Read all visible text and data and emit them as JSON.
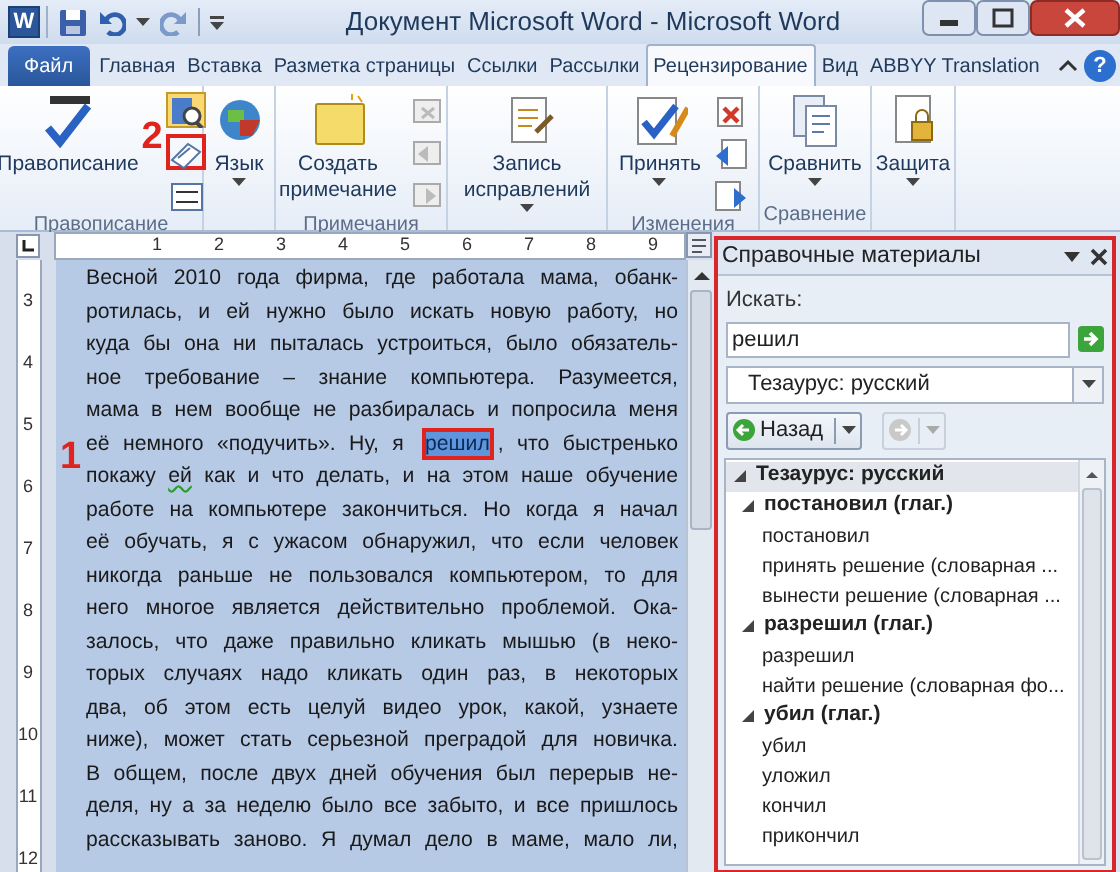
{
  "window": {
    "app_logo": "W",
    "title": "Документ Microsoft Word - Microsoft Word"
  },
  "tabs": [
    {
      "label": "Файл",
      "kind": "file",
      "selected": false
    },
    {
      "label": "Главная",
      "kind": "tab",
      "selected": false
    },
    {
      "label": "Вставка",
      "kind": "tab",
      "selected": false
    },
    {
      "label": "Разметка страницы",
      "kind": "tab",
      "selected": false
    },
    {
      "label": "Ссылки",
      "kind": "tab",
      "selected": false
    },
    {
      "label": "Рассылки",
      "kind": "tab",
      "selected": false
    },
    {
      "label": "Рецензирование",
      "kind": "tab",
      "selected": true
    },
    {
      "label": "Вид",
      "kind": "tab",
      "selected": false
    },
    {
      "label": "ABBYY Translation",
      "kind": "tab",
      "selected": false
    }
  ],
  "help_button": {
    "label": "?"
  },
  "ribbon_groups": [
    {
      "caption": "Правописание",
      "buttons": [
        {
          "kind": "large",
          "label": "Правописание",
          "has_menu": false
        },
        {
          "kind": "small",
          "pressed": true
        },
        {
          "kind": "small",
          "pressed": false,
          "callout": "2"
        },
        {
          "kind": "small",
          "pressed": false
        }
      ]
    },
    {
      "buttons": [
        {
          "kind": "large",
          "label": "Язык",
          "has_menu": true
        }
      ]
    },
    {
      "caption": "Примечания",
      "buttons": [
        {
          "kind": "large",
          "label": "Создать примечание",
          "has_menu": false
        },
        {
          "kind": "small",
          "pressed": false
        },
        {
          "kind": "small",
          "pressed": false
        },
        {
          "kind": "small",
          "pressed": false
        }
      ]
    },
    {
      "buttons": [
        {
          "kind": "large",
          "label": "Запись исправлений",
          "has_menu": true
        }
      ]
    },
    {
      "caption": "Изменения",
      "buttons": [
        {
          "kind": "large",
          "label": "Принять",
          "has_menu": true
        },
        {
          "kind": "small",
          "pressed": false
        },
        {
          "kind": "small",
          "pressed": false
        },
        {
          "kind": "small",
          "pressed": false
        }
      ]
    },
    {
      "caption": "Сравнение",
      "buttons": [
        {
          "kind": "large",
          "label": "Сравнить",
          "has_menu": true
        }
      ]
    },
    {
      "buttons": [
        {
          "kind": "large",
          "label": "Защита",
          "has_menu": true
        }
      ]
    }
  ],
  "ruler": {
    "horizontal": [
      "1",
      "2",
      "3",
      "4",
      "5",
      "6",
      "7",
      "8",
      "9"
    ],
    "vertical": [
      "3",
      "4",
      "5",
      "6",
      "7",
      "8",
      "9",
      "10",
      "11",
      "12"
    ]
  },
  "document": {
    "lines": [
      {
        "spans": [
          {
            "text": "Весной 2010 года фирма, где работала мама, обанк-"
          }
        ]
      },
      {
        "spans": [
          {
            "text": "ротилась, и ей нужно было искать новую работу, но"
          }
        ]
      },
      {
        "spans": [
          {
            "text": "куда бы она ни пыталась устроиться, было обязатель-"
          }
        ]
      },
      {
        "spans": [
          {
            "text": "ное требование – знание компьютера. Разумеется,"
          }
        ]
      },
      {
        "spans": [
          {
            "text": "мама в нем вообще не разбиралась и попросила меня"
          }
        ]
      },
      {
        "spans": [
          {
            "text": "её немного «подучить». Ну, я "
          },
          {
            "text": "решил",
            "selected": true,
            "callout": "1"
          },
          {
            "text": ", что быстренько"
          }
        ]
      },
      {
        "spans": [
          {
            "text": "покажу "
          },
          {
            "text": "ей",
            "grammar_error": true
          },
          {
            "text": " как и что делать, и на этом наше обучение"
          }
        ]
      },
      {
        "spans": [
          {
            "text": "работе на компьютере закончиться. Но когда я начал"
          }
        ]
      },
      {
        "spans": [
          {
            "text": "её обучать, я с ужасом обнаружил, что если человек"
          }
        ]
      },
      {
        "spans": [
          {
            "text": "никогда раньше не пользовался компьютером, то для"
          }
        ]
      },
      {
        "spans": [
          {
            "text": "него многое является действительно проблемой. Ока-"
          }
        ]
      },
      {
        "spans": [
          {
            "text": "залось, что даже правильно кликать мышью (в неко-"
          }
        ]
      },
      {
        "spans": [
          {
            "text": "торых случаях надо кликать один раз, в некоторых"
          }
        ]
      },
      {
        "spans": [
          {
            "text": "два, об этом есть целуй видео урок, какой, узнаете"
          }
        ]
      },
      {
        "spans": [
          {
            "text": "ниже), может стать серьезной преградой для новичка."
          }
        ]
      },
      {
        "spans": [
          {
            "text": "В общем, после двух дней обучения был перерыв не-"
          }
        ]
      },
      {
        "spans": [
          {
            "text": "деля, ну а за неделю было все забыто, и все пришлось"
          }
        ]
      },
      {
        "spans": [
          {
            "text": "рассказывать заново. Я думал дело в маме, мало ли,"
          }
        ]
      }
    ]
  },
  "reference_pane": {
    "title": "Справочные материалы",
    "search_label": "Искать:",
    "search_value": "решил",
    "source": "Тезаурус: русский",
    "back_button": {
      "label": "Назад",
      "disabled": false
    },
    "forward_button": {
      "disabled": true
    },
    "tree": [
      {
        "label": "Тезаурус: русский",
        "kind": "root",
        "expanded": true,
        "children": [
          {
            "label": "постановил (глаг.)",
            "kind": "group",
            "expanded": true,
            "children": [
              {
                "label": "постановил",
                "kind": "leaf"
              },
              {
                "label": "принять решение (словарная ...",
                "kind": "leaf"
              },
              {
                "label": "вынести решение (словарная ...",
                "kind": "leaf"
              }
            ]
          },
          {
            "label": "разрешил (глаг.)",
            "kind": "group",
            "expanded": true,
            "children": [
              {
                "label": "разрешил",
                "kind": "leaf"
              },
              {
                "label": "найти решение (словарная фо...",
                "kind": "leaf"
              }
            ]
          },
          {
            "label": "убил (глаг.)",
            "kind": "group",
            "expanded": true,
            "children": [
              {
                "label": "убил",
                "kind": "leaf"
              },
              {
                "label": "уложил",
                "kind": "leaf"
              },
              {
                "label": "кончил",
                "kind": "leaf"
              },
              {
                "label": "прикончил",
                "kind": "leaf"
              }
            ]
          }
        ]
      }
    ]
  }
}
